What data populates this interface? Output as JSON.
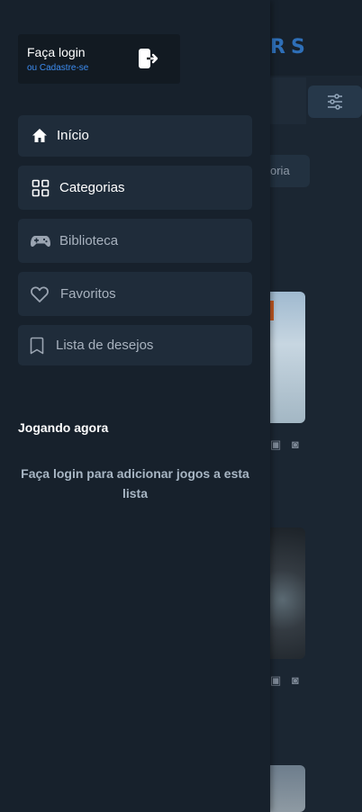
{
  "drawer": {
    "login": {
      "title": "Faça login",
      "subtitle": "ou Cadastre-se"
    },
    "nav": [
      {
        "label": "Início",
        "icon": "home-icon"
      },
      {
        "label": "Categorias",
        "icon": "grid-icon"
      },
      {
        "label": "Biblioteca",
        "icon": "gamepad-icon"
      },
      {
        "label": "Favoritos",
        "icon": "heart-icon"
      },
      {
        "label": "Lista de desejos",
        "icon": "bookmark-icon"
      }
    ],
    "now_playing": {
      "title": "Jogando agora",
      "empty_message": "Faça login para adicionar jogos a esta lista"
    }
  },
  "background": {
    "logo_partial": "RS",
    "chip_partial": "oria"
  },
  "colors": {
    "accent": "#3d8cf0",
    "drawer_bg": "#17212c",
    "item_bg": "#1f2c3a"
  }
}
